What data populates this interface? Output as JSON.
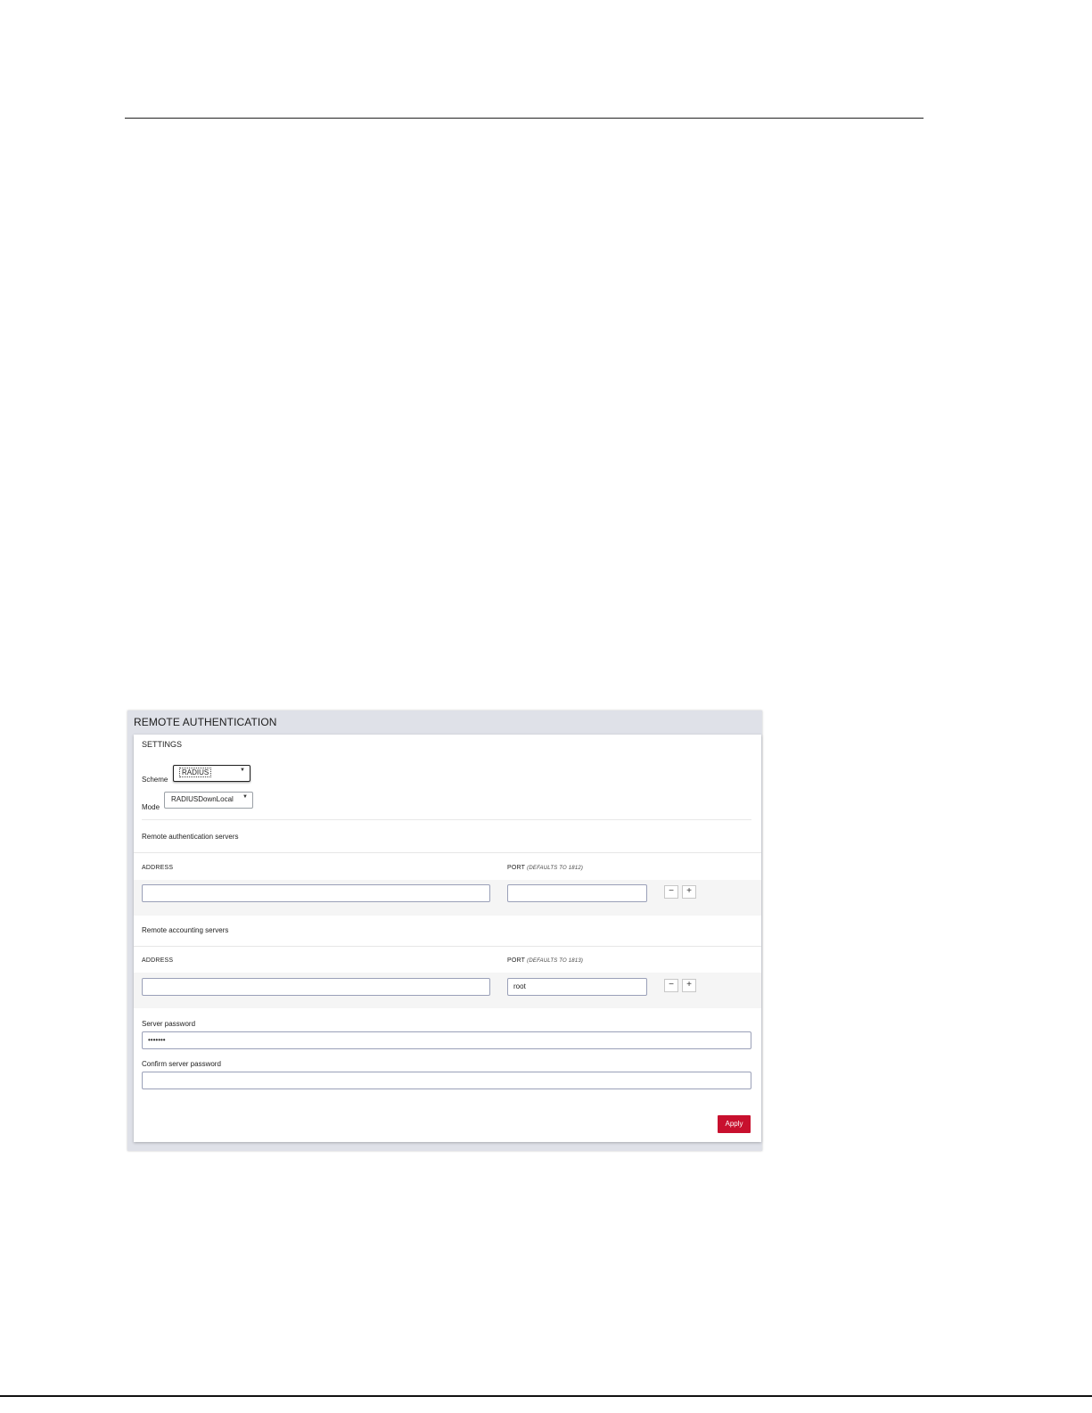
{
  "panel": {
    "title": "REMOTE AUTHENTICATION",
    "settings_title": "SETTINGS"
  },
  "settings": {
    "scheme_label": "Scheme",
    "scheme_value": "RADIUS",
    "mode_label": "Mode",
    "mode_value": "RADIUSDownLocal"
  },
  "auth_servers": {
    "section_label": "Remote authentication servers",
    "address_header": "ADDRESS",
    "port_header": "PORT",
    "port_note": "(DEFAULTS TO 1812)",
    "address_value": "",
    "port_value": "",
    "remove_label": "−",
    "add_label": "+"
  },
  "acct_servers": {
    "section_label": "Remote accounting servers",
    "address_header": "ADDRESS",
    "port_header": "PORT",
    "port_note": "(DEFAULTS TO 1813)",
    "address_value": "",
    "port_value": "root",
    "remove_label": "−",
    "add_label": "+"
  },
  "password": {
    "server_password_label": "Server password",
    "server_password_value": "•••••••",
    "confirm_label": "Confirm server password",
    "confirm_value": ""
  },
  "actions": {
    "apply_label": "Apply",
    "apply_color": "#c8102e"
  }
}
